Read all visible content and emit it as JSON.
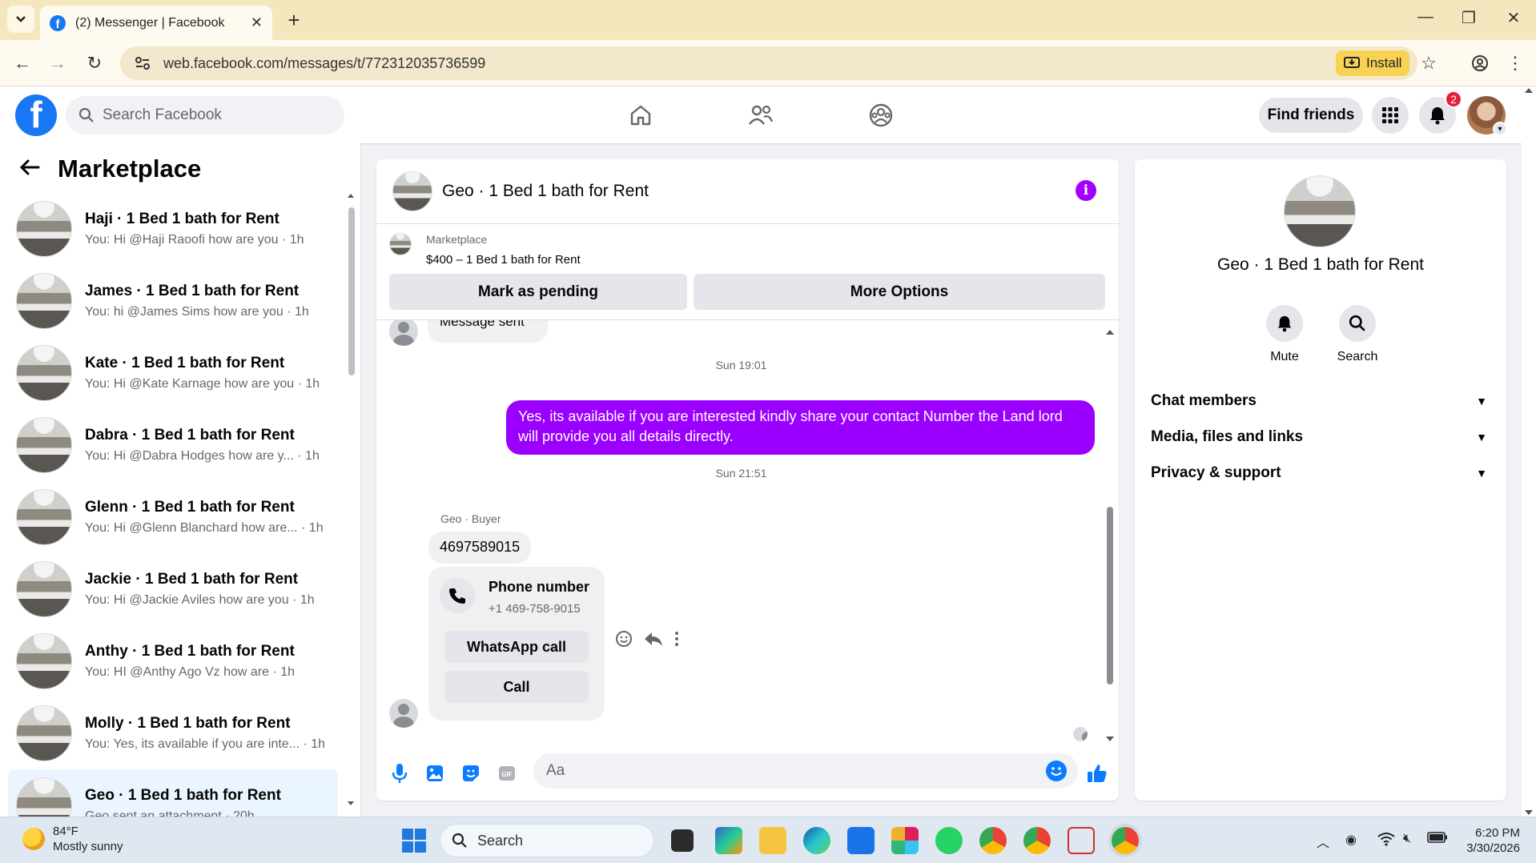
{
  "browser": {
    "tab_title": "(2) Messenger | Facebook",
    "url": "web.facebook.com/messages/t/772312035736599",
    "install_label": "Install"
  },
  "header": {
    "search_placeholder": "Search Facebook",
    "find_friends_label": "Find friends",
    "notification_count": "2",
    "brand_color": "#1877f2"
  },
  "sidebar": {
    "title": "Marketplace",
    "conversations": [
      {
        "name": "Haji · 1 Bed 1 bath for Rent",
        "preview": "You: Hi @Haji Raoofi how are you · 1h"
      },
      {
        "name": "James · 1 Bed 1 bath for Rent",
        "preview": "You: hi @James Sims how are you · 1h"
      },
      {
        "name": "Kate · 1 Bed 1 bath for Rent",
        "preview": "You: Hi @Kate Karnage how are you · 1h"
      },
      {
        "name": "Dabra · 1 Bed 1 bath for Rent",
        "preview": "You: Hi @Dabra Hodges how are y... · 1h"
      },
      {
        "name": "Glenn · 1 Bed 1 bath for Rent",
        "preview": "You: Hi @Glenn Blanchard how are... · 1h"
      },
      {
        "name": "Jackie · 1 Bed 1 bath for Rent",
        "preview": "You: Hi @Jackie Aviles how are you · 1h"
      },
      {
        "name": "Anthy · 1 Bed 1 bath for Rent",
        "preview": "You: HI @Anthy Ago Vz how are · 1h"
      },
      {
        "name": "Molly · 1 Bed 1 bath for Rent",
        "preview": "You: Yes, its available if you are inte... · 1h"
      },
      {
        "name": "Geo · 1 Bed 1 bath for Rent",
        "preview": "Geo sent an attachment · 20h"
      }
    ]
  },
  "chat": {
    "title": "Geo · 1 Bed 1 bath for Rent",
    "marketplace_label": "Marketplace",
    "listing": "$400 – 1 Bed 1 bath for Rent",
    "mark_pending_label": "Mark as pending",
    "more_options_label": "More Options",
    "ghost_message": "Message sent",
    "timestamp_1": "Sun 19:01",
    "outgoing_message": "Yes, its available if you are interested kindly share your contact Number the Land lord will provide you all details directly.",
    "timestamp_2": "Sun 21:51",
    "sender_label": "Geo · Buyer",
    "incoming_message": "4697589015",
    "phone_card_title": "Phone number",
    "phone_card_number": "+1 469-758-9015",
    "whatsapp_call_label": "WhatsApp call",
    "call_label": "Call",
    "composer_placeholder": "Aa",
    "accent_color": "#9b00ff"
  },
  "info_panel": {
    "title": "Geo · 1 Bed 1 bath for Rent",
    "mute_label": "Mute",
    "search_label": "Search",
    "sections": [
      "Chat members",
      "Media, files and links",
      "Privacy & support"
    ]
  },
  "taskbar": {
    "temperature": "84°F",
    "weather": "Mostly sunny",
    "search_label": "Search",
    "time": "6:20 PM",
    "date": "3/30/2026"
  }
}
